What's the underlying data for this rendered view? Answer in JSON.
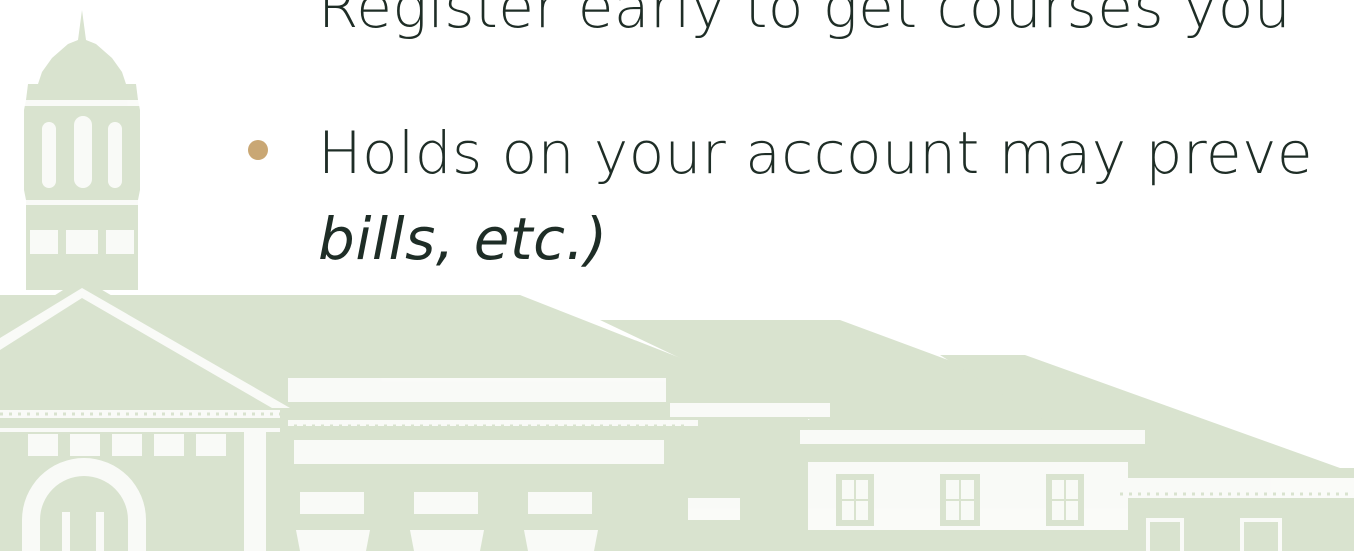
{
  "slide": {
    "bullets": [
      {
        "text": "Register early to get courses you"
      },
      {
        "text": "Holds on your account may preve",
        "continuation": "bills, etc.)"
      }
    ]
  },
  "colors": {
    "bullet_dot": "#c9a774",
    "text": "#1e2d26",
    "building_fill": "#d9e3cf",
    "building_light": "#ffffff"
  },
  "icons": {
    "background": "campus-building-illustration"
  }
}
